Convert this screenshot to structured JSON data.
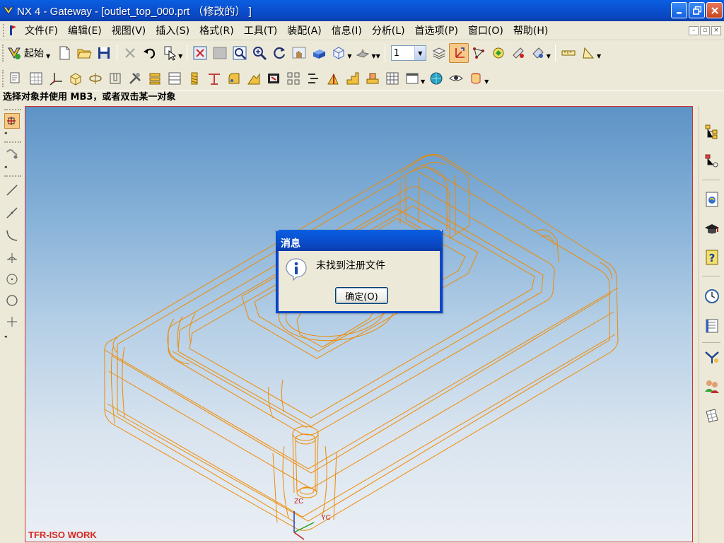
{
  "window": {
    "title": "NX 4 - Gateway - [outlet_top_000.prt （修改的） ]",
    "controls": [
      "minimize",
      "restore",
      "close"
    ]
  },
  "menubar": {
    "items": [
      {
        "label": "文件(F)",
        "key": "file"
      },
      {
        "label": "编辑(E)",
        "key": "edit"
      },
      {
        "label": "视图(V)",
        "key": "view"
      },
      {
        "label": "插入(S)",
        "key": "insert"
      },
      {
        "label": "格式(R)",
        "key": "format"
      },
      {
        "label": "工具(T)",
        "key": "tools"
      },
      {
        "label": "装配(A)",
        "key": "assembly"
      },
      {
        "label": "信息(I)",
        "key": "info"
      },
      {
        "label": "分析(L)",
        "key": "analysis"
      },
      {
        "label": "首选项(P)",
        "key": "preferences"
      },
      {
        "label": "窗口(O)",
        "key": "window"
      },
      {
        "label": "帮助(H)",
        "key": "help"
      }
    ]
  },
  "toolbar1": {
    "start_label": "起始",
    "layer_value": "1"
  },
  "cue_line": "选择对象并使用 MB3，或者双击某一对象",
  "viewport": {
    "wcs_label": "TFR-ISO WORK",
    "axis_labels": {
      "zc": "ZC",
      "yc": "YC"
    },
    "wire_color": "#f08a00"
  },
  "dialog": {
    "title": "消息",
    "message": "未找到注册文件",
    "ok_label": "确定(O)",
    "icon": "info-icon"
  },
  "colors": {
    "titlebar": "#0a50d0",
    "chrome": "#ece9d8",
    "wireframe": "#f08a00",
    "wcs_label": "#d8281c"
  }
}
